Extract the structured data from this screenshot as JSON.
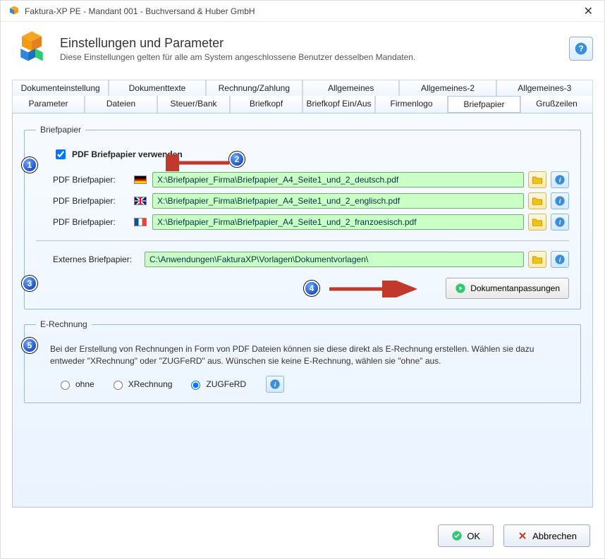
{
  "window": {
    "title": "Faktura-XP PE - Mandant 001 - Buchversand & Huber GmbH"
  },
  "header": {
    "title": "Einstellungen und Parameter",
    "subtitle": "Diese Einstellungen gelten für alle am System angeschlossene Benutzer desselben Mandaten."
  },
  "tabs_row1": [
    "Dokumenteinstellung",
    "Dokumenttexte",
    "Rechnung/Zahlung",
    "Allgemeines",
    "Allgemeines-2",
    "Allgemeines-3"
  ],
  "tabs_row2": [
    "Parameter",
    "Dateien",
    "Steuer/Bank",
    "Briefkopf",
    "Briefkopf Ein/Aus",
    "Firmenlogo",
    "Briefpapier",
    "Grußzeilen"
  ],
  "active_tab": "Briefpapier",
  "briefpapier": {
    "legend": "Briefpapier",
    "use_pdf_label": "PDF Briefpapier verwenden",
    "use_pdf_checked": true,
    "rows": [
      {
        "label": "PDF Briefpapier:",
        "flag": "de",
        "path": "X:\\Briefpapier_Firma\\Briefpapier_A4_Seite1_und_2_deutsch.pdf"
      },
      {
        "label": "PDF Briefpapier:",
        "flag": "gb",
        "path": "X:\\Briefpapier_Firma\\Briefpapier_A4_Seite1_und_2_englisch.pdf"
      },
      {
        "label": "PDF Briefpapier:",
        "flag": "fr",
        "path": "X:\\Briefpapier_Firma\\Briefpapier_A4_Seite1_und_2_franzoesisch.pdf"
      }
    ],
    "ext_label": "Externes Briefpapier:",
    "ext_path": "C:\\Anwendungen\\FakturaXP\\Vorlagen\\Dokumentvorlagen\\",
    "adjust_button": "Dokumentanpassungen"
  },
  "erechnung": {
    "legend": "E-Rechnung",
    "text": "Bei der Erstellung von Rechnungen in Form von PDF Dateien können sie diese direkt als E-Rechnung erstellen. Wählen sie dazu entweder \"XRechnung\" oder \"ZUGFeRD\" aus. Wünschen sie keine E-Rechnung, wählen sie \"ohne\" aus.",
    "options": [
      "ohne",
      "XRechnung",
      "ZUGFeRD"
    ],
    "selected": "ZUGFeRD"
  },
  "footer": {
    "ok": "OK",
    "cancel": "Abbrechen"
  },
  "callouts": {
    "b1": "1",
    "b2": "2",
    "b3": "3",
    "b4": "4",
    "b5": "5"
  }
}
